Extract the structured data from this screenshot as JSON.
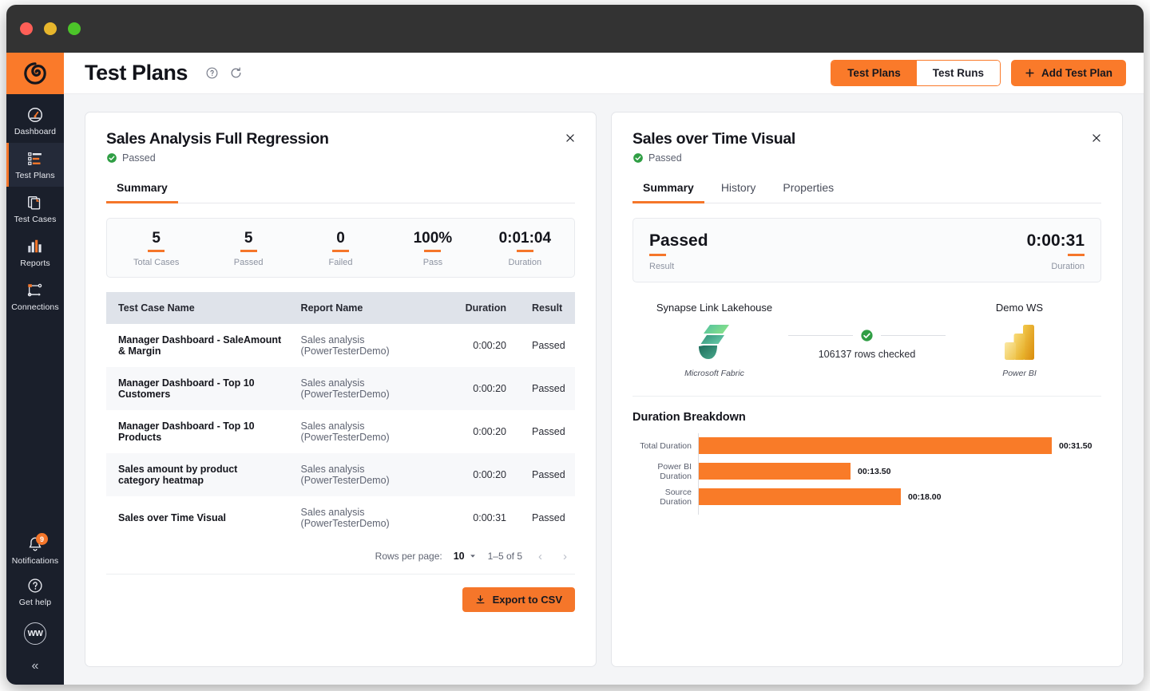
{
  "window": {
    "controls": [
      "close",
      "minimize",
      "maximize"
    ]
  },
  "sidebar": {
    "logo_alt": "PowerTester logo",
    "items": [
      {
        "label": "Dashboard",
        "icon": "dashboard-icon",
        "active": false
      },
      {
        "label": "Test Plans",
        "icon": "test-plans-icon",
        "active": true
      },
      {
        "label": "Test Cases",
        "icon": "test-cases-icon",
        "active": false
      },
      {
        "label": "Reports",
        "icon": "reports-icon",
        "active": false
      },
      {
        "label": "Connections",
        "icon": "connections-icon",
        "active": false
      }
    ],
    "bottom": [
      {
        "label": "Notifications",
        "icon": "bell-icon",
        "badge": "9"
      },
      {
        "label": "Get help",
        "icon": "question-circle-icon"
      }
    ],
    "avatar_initials": "WW",
    "collapse_glyph": "«"
  },
  "header": {
    "title": "Test Plans",
    "help_icon": "help-circle-icon",
    "refresh_icon": "refresh-icon",
    "segmented": [
      {
        "label": "Test Plans",
        "selected": true
      },
      {
        "label": "Test Runs",
        "selected": false
      }
    ],
    "add_button": "Add Test Plan",
    "add_button_icon": "plus-icon"
  },
  "left_panel": {
    "title": "Sales Analysis Full Regression",
    "status": "Passed",
    "status_icon": "check-circle-icon",
    "close_icon": "close-icon",
    "tabs": [
      {
        "label": "Summary",
        "selected": true
      }
    ],
    "stats": [
      {
        "value": "5",
        "label": "Total Cases"
      },
      {
        "value": "5",
        "label": "Passed"
      },
      {
        "value": "0",
        "label": "Failed"
      },
      {
        "value": "100%",
        "label": "Pass"
      },
      {
        "value": "0:01:04",
        "label": "Duration"
      }
    ],
    "table": {
      "columns": [
        "Test Case Name",
        "Report Name",
        "Duration",
        "Result"
      ],
      "rows": [
        {
          "name": "Manager Dashboard - SaleAmount & Margin",
          "report": "Sales analysis (PowerTesterDemo)",
          "duration": "0:00:20",
          "result": "Passed"
        },
        {
          "name": "Manager Dashboard - Top 10 Customers",
          "report": "Sales analysis (PowerTesterDemo)",
          "duration": "0:00:20",
          "result": "Passed"
        },
        {
          "name": "Manager Dashboard - Top 10 Products",
          "report": "Sales analysis (PowerTesterDemo)",
          "duration": "0:00:20",
          "result": "Passed"
        },
        {
          "name": "Sales amount by product category heatmap",
          "report": "Sales analysis (PowerTesterDemo)",
          "duration": "0:00:20",
          "result": "Passed"
        },
        {
          "name": "Sales over Time Visual",
          "report": "Sales analysis (PowerTesterDemo)",
          "duration": "0:00:31",
          "result": "Passed"
        }
      ]
    },
    "pagination": {
      "rows_per_page_label": "Rows per page:",
      "rows_per_page_value": "10",
      "range": "1–5 of 5",
      "prev_glyph": "‹",
      "next_glyph": "›"
    },
    "export_button": "Export to CSV",
    "export_icon": "download-icon"
  },
  "right_panel": {
    "title": "Sales over Time Visual",
    "status": "Passed",
    "status_icon": "check-circle-icon",
    "close_icon": "close-icon",
    "tabs": [
      {
        "label": "Summary",
        "selected": true
      },
      {
        "label": "History",
        "selected": false
      },
      {
        "label": "Properties",
        "selected": false
      }
    ],
    "result_box": {
      "result_value": "Passed",
      "result_label": "Result",
      "duration_value": "0:00:31",
      "duration_label": "Duration"
    },
    "flow": {
      "source": {
        "name": "Synapse Link Lakehouse",
        "product": "Microsoft Fabric",
        "icon": "microsoft-fabric-icon"
      },
      "target": {
        "name": "Demo WS",
        "product": "Power BI",
        "icon": "power-bi-icon"
      },
      "connector_text": "106137 rows checked",
      "connector_icon": "check-circle-icon"
    },
    "chart_data": {
      "type": "bar",
      "title": "Duration Breakdown",
      "orientation": "horizontal",
      "categories": [
        "Total Duration",
        "Power BI Duration",
        "Source Duration"
      ],
      "values": [
        31.5,
        13.5,
        18.0
      ],
      "value_labels": [
        "00:31.50",
        "00:13.50",
        "00:18.00"
      ],
      "bar_color": "#f97b28",
      "xlabel": "",
      "ylabel": "",
      "xlim": [
        0,
        31.5
      ],
      "grid": false,
      "legend": "none"
    }
  },
  "colors": {
    "accent": "#fa7a2a",
    "sidebar": "#1a1f2b",
    "sidebar_active": "#242a39",
    "pass_green": "#2f9e44",
    "page_bg": "#f4f5f7"
  }
}
